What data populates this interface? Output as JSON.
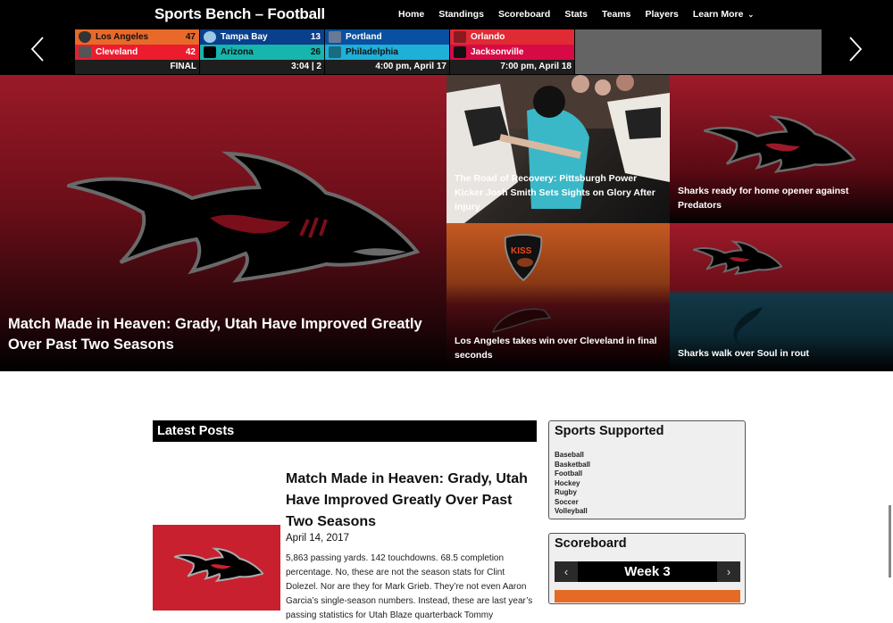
{
  "header": {
    "site_title": "Sports Bench – Football",
    "nav": [
      {
        "label": "Home"
      },
      {
        "label": "Standings"
      },
      {
        "label": "Scoreboard"
      },
      {
        "label": "Stats"
      },
      {
        "label": "Teams"
      },
      {
        "label": "Players"
      },
      {
        "label": "Learn More",
        "has_dropdown": true
      }
    ],
    "prev_icon": "chevron-left-icon",
    "next_icon": "chevron-right-icon"
  },
  "ticker": {
    "games": [
      {
        "away": {
          "name": "Los Angeles",
          "score": "47",
          "color": "#e8692a"
        },
        "home": {
          "name": "Cleveland",
          "score": "42",
          "color": "#ec1c2e"
        },
        "status": "FINAL"
      },
      {
        "away": {
          "name": "Tampa Bay",
          "score": "13",
          "color": "#0a3f8c"
        },
        "home": {
          "name": "Arizona",
          "score": "26",
          "color": "#16b5ad"
        },
        "status": "3:04 | 2"
      },
      {
        "away": {
          "name": "Portland",
          "score": "",
          "color": "#0a50a0"
        },
        "home": {
          "name": "Philadelphia",
          "score": "",
          "color": "#1fb0d8"
        },
        "status": "4:00 pm, April 17"
      },
      {
        "away": {
          "name": "Orlando",
          "score": "",
          "color": "#e02a34"
        },
        "home": {
          "name": "Jacksonville",
          "score": "",
          "color": "#d80a46"
        },
        "status": "7:00 pm, April 18"
      }
    ]
  },
  "hero": {
    "main": {
      "title": "Match Made in Heaven: Grady, Utah Have Improved Greatly Over Past Two Seasons"
    },
    "tiles": [
      {
        "title": "The Road of Recovery: Pittsburgh Power Kicker Josh Smith Sets Sights on Glory After Injury"
      },
      {
        "title": "Sharks ready for home opener against Predators"
      },
      {
        "title": "Los Angeles takes win over Cleveland in final seconds"
      },
      {
        "title": "Sharks walk over Soul in rout"
      }
    ]
  },
  "latest": {
    "heading": "Latest Posts",
    "posts": [
      {
        "title": "Match Made in Heaven: Grady, Utah Have Improved Greatly Over Past Two Seasons",
        "date": "April 14, 2017",
        "excerpt": "5,863 passing yards. 142 touchdowns. 68.5 completion percentage. No, these are not the season stats for Clint Dolezel. Nor are they for Mark Grieb. They’re not even Aaron Garcia’s single-season numbers. Instead, these are last year’s passing statistics for Utah Blaze quarterback Tommy"
      }
    ]
  },
  "sidebar": {
    "sports": {
      "heading": "Sports Supported",
      "items": [
        "Baseball",
        "Basketball",
        "Football",
        "Hockey",
        "Rugby",
        "Soccer",
        "Volleyball"
      ]
    },
    "scoreboard": {
      "heading": "Scoreboard",
      "week_label": "Week 3",
      "prev": "‹",
      "next": "›"
    }
  }
}
